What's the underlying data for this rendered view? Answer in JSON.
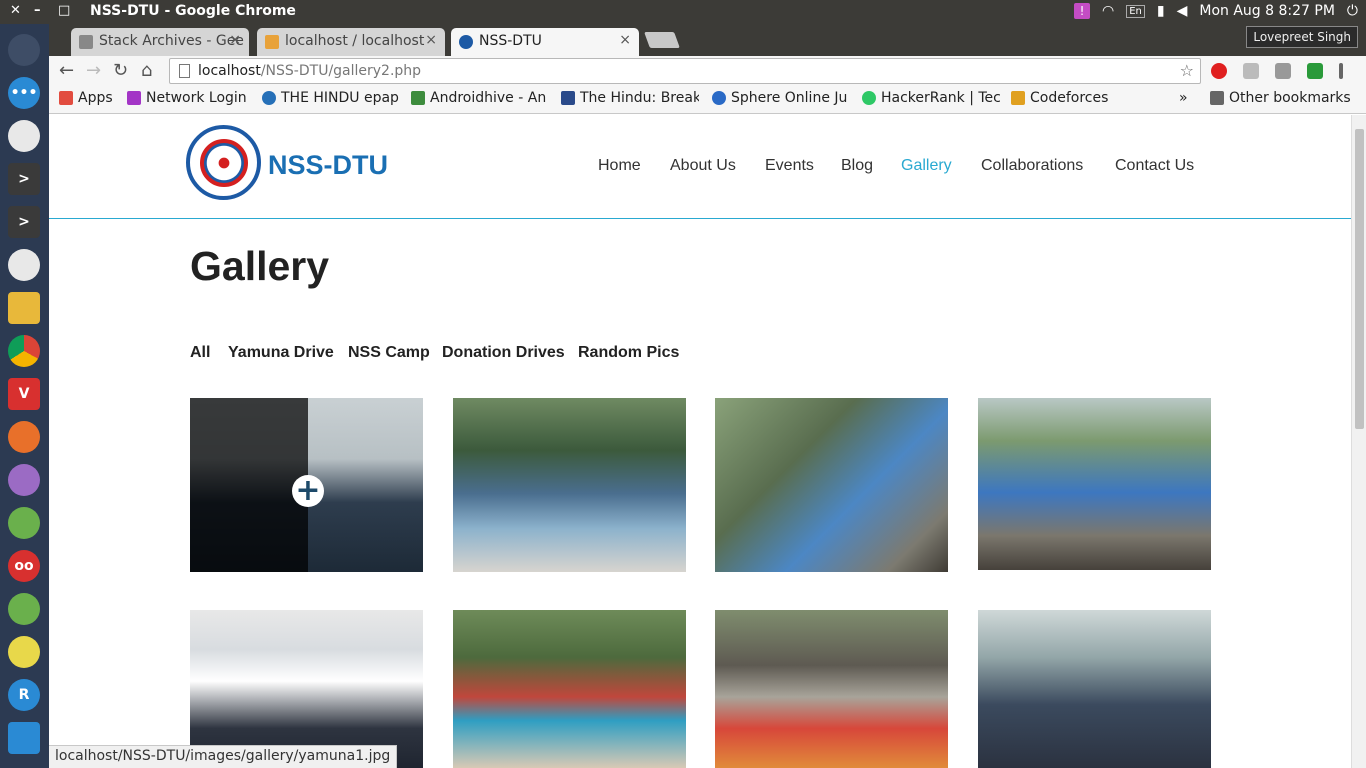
{
  "os": {
    "window_title": "NSS-DTU - Google Chrome",
    "close": "✕",
    "minimize": "–",
    "maximize": "□",
    "tray_badge": "!",
    "lang": "En",
    "datetime": "Mon Aug  8  8:27 PM"
  },
  "browser": {
    "tabs": [
      {
        "label": "Stack Archives - Gee",
        "favicon_color": "#888888"
      },
      {
        "label": "localhost / localhost",
        "favicon_color": "#e8a23a"
      },
      {
        "label": "NSS-DTU",
        "favicon_color": "#1d5aa5"
      }
    ],
    "tab_close": "×",
    "profile": "Lovepreet Singh",
    "url_host": "localhost",
    "url_path": "/NSS-DTU/gallery2.php",
    "back": "←",
    "forward": "→",
    "reload": "↻",
    "home": "⌂",
    "star": "☆",
    "bookmarks": [
      {
        "label": "Apps",
        "color": "#e24c3f"
      },
      {
        "label": "Network Login",
        "color": "#a335c6"
      },
      {
        "label": "THE HINDU epap",
        "color": "#2670b8"
      },
      {
        "label": "Androidhive - An",
        "color": "#3d8c3d"
      },
      {
        "label": "The Hindu: Break",
        "color": "#2a4a8a"
      },
      {
        "label": "Sphere Online Ju",
        "color": "#2a6ac6"
      },
      {
        "label": "HackerRank | Tec",
        "color": "#2ec866"
      },
      {
        "label": "Codeforces",
        "color": "#e0a020"
      }
    ],
    "bookmarks_more": "»",
    "other_bookmarks": "Other bookmarks",
    "status_url": "localhost/NSS-DTU/images/gallery/yamuna1.jpg"
  },
  "site": {
    "brand": "NSS-DTU",
    "menu": [
      "Home",
      "About Us",
      "Events",
      "Blog",
      "Gallery",
      "Collaborations",
      "Contact Us"
    ],
    "active_menu": "Gallery",
    "heading": "Gallery",
    "filters": [
      "All",
      "Yamuna Drive",
      "NSS Camp",
      "Donation Drives",
      "Random Pics"
    ],
    "plus": "+"
  }
}
